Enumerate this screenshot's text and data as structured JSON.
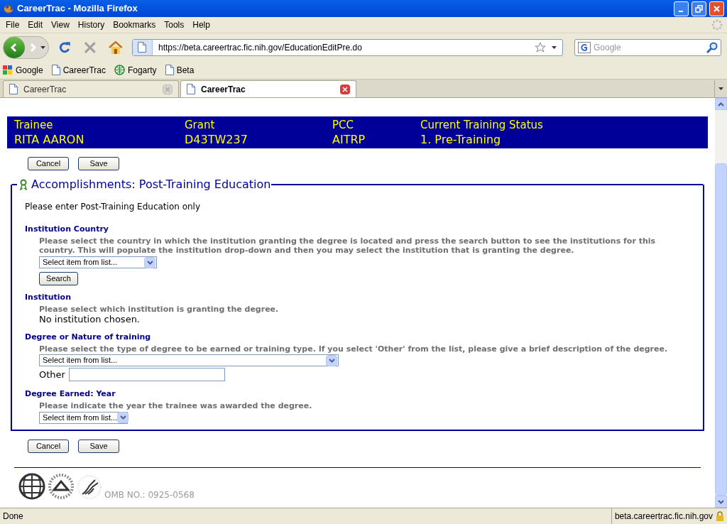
{
  "window": {
    "title": "CareerTrac - Mozilla Firefox"
  },
  "menu": [
    "File",
    "Edit",
    "View",
    "History",
    "Bookmarks",
    "Tools",
    "Help"
  ],
  "url": "https://beta.careertrac.fic.nih.gov/EducationEditPre.do",
  "search": {
    "placeholder": "Google"
  },
  "bookmarks": [
    {
      "kind": "google",
      "label": "Google"
    },
    {
      "kind": "page",
      "label": "CareerTrac"
    },
    {
      "kind": "fogarty",
      "label": "Fogarty"
    },
    {
      "kind": "page",
      "label": "Beta"
    }
  ],
  "tabs": [
    {
      "label": "CareerTrac",
      "selected": false
    },
    {
      "label": "CareerTrac",
      "selected": true
    }
  ],
  "header": [
    {
      "label": "Trainee",
      "value": "RITA AARON"
    },
    {
      "label": "Grant",
      "value": "D43TW237"
    },
    {
      "label": "PCC",
      "value": "AITRP"
    },
    {
      "label": "Current Training Status",
      "value": "1. Pre-Training"
    }
  ],
  "buttons_top": [
    "Cancel",
    "Save"
  ],
  "section": {
    "title": "Accomplishments: Post-Training Education",
    "intro": "Please enter Post-Training Education only",
    "fields": [
      {
        "kind": "select_search",
        "label": "Institution Country",
        "help": "Please select the country in which the institution granting the degree is located and press the search button to see the institutions for this country. This will populate the institution drop-down and then you may select the institution that is granting the degree.",
        "select": "Select item from list...",
        "button": "Search"
      },
      {
        "kind": "text",
        "label": "Institution",
        "help": "Please select which institution is granting the degree.",
        "value": "No institution chosen."
      },
      {
        "kind": "select_other",
        "label": "Degree or Nature of training",
        "help": "Please select the type of degree to be earned or training type. If you select 'Other' from the list, please give a brief description of the degree.",
        "select": "Select item from list...",
        "other_label": "Other"
      },
      {
        "kind": "select",
        "label": "Degree Earned: Year",
        "help": "Please indicate the year the trainee was awarded the degree.",
        "select": "Select item from list..."
      }
    ]
  },
  "buttons_bottom": [
    "Cancel",
    "Save"
  ],
  "footer": {
    "omb": "OMB NO.: 0925-0568"
  },
  "status_bar": {
    "left": "Done",
    "right": "beta.careertrac.fic.nih.gov"
  }
}
